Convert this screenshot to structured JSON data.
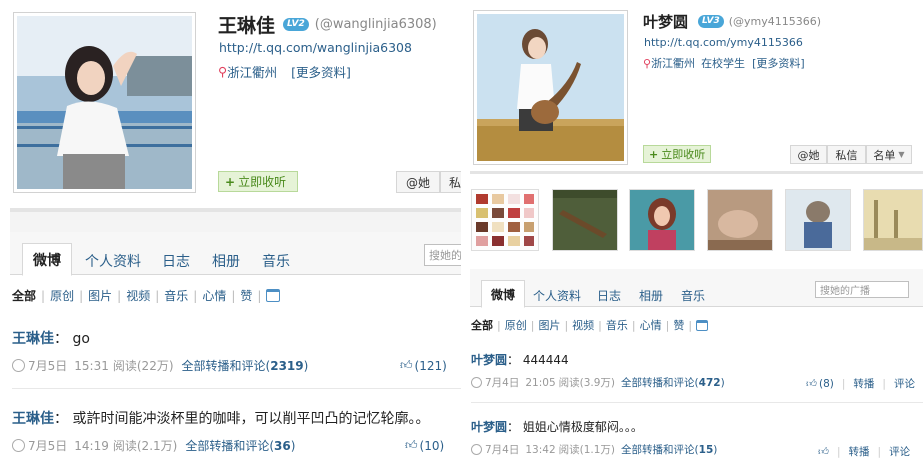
{
  "left": {
    "profile": {
      "name": "王琳佳",
      "level_badge": "LV2",
      "handle": "(@wanglinjia6308)",
      "url": "http://t.qq.com/wanglinjia6308",
      "location": "浙江衢州",
      "more_info": "[更多资料]",
      "follow_label": "立即收听",
      "at_label": "@她",
      "msg_label": "私"
    },
    "tabs": [
      "微博",
      "个人资料",
      "日志",
      "相册",
      "音乐"
    ],
    "search_placeholder": "搜她的",
    "filters": [
      "全部",
      "原创",
      "图片",
      "视频",
      "音乐",
      "心情",
      "赞"
    ],
    "posts": [
      {
        "author": "王琳佳",
        "text": "go",
        "date": "7月5日",
        "time": "15:31",
        "reads": "阅读(22万)",
        "link": "全部转播和评论",
        "count": "2319",
        "likes": "(121)"
      },
      {
        "author": "王琳佳",
        "text": "或許时间能冲淡杯里的咖啡，可以削平凹凸的记忆轮廓。。",
        "date": "7月5日",
        "time": "14:19",
        "reads": "阅读(2.1万)",
        "link": "全部转播和评论",
        "count": "36",
        "likes": "(10)"
      }
    ]
  },
  "right": {
    "profile": {
      "name": "叶梦圆",
      "level_badge": "LV3",
      "handle": "(@ymy4115366)",
      "url": "http://t.qq.com/ymy4115366",
      "location": "浙江衢州",
      "status": "在校学生",
      "more_info": "[更多资料]",
      "follow_label": "立即收听",
      "at_label": "@她",
      "msg_label": "私信",
      "name_menu_label": "名单"
    },
    "tabs": [
      "微博",
      "个人资料",
      "日志",
      "相册",
      "音乐"
    ],
    "search_placeholder": "搜她的广播",
    "filters": [
      "全部",
      "原创",
      "图片",
      "视频",
      "音乐",
      "心情",
      "赞"
    ],
    "posts": [
      {
        "author": "叶梦圆",
        "text": "444444",
        "date": "7月4日",
        "time": "21:05",
        "reads": "阅读(3.9万)",
        "link": "全部转播和评论",
        "count": "472",
        "likes": "(8)",
        "repost": "转播",
        "comment": "评论"
      },
      {
        "author": "叶梦圆",
        "text": "姐姐心情极度郁闷。。。",
        "date": "7月4日",
        "time": "13:42",
        "reads": "阅读(1.1万)",
        "link": "全部转播和评论",
        "count": "15",
        "likes": "",
        "repost": "转播",
        "comment": "评论"
      }
    ]
  }
}
